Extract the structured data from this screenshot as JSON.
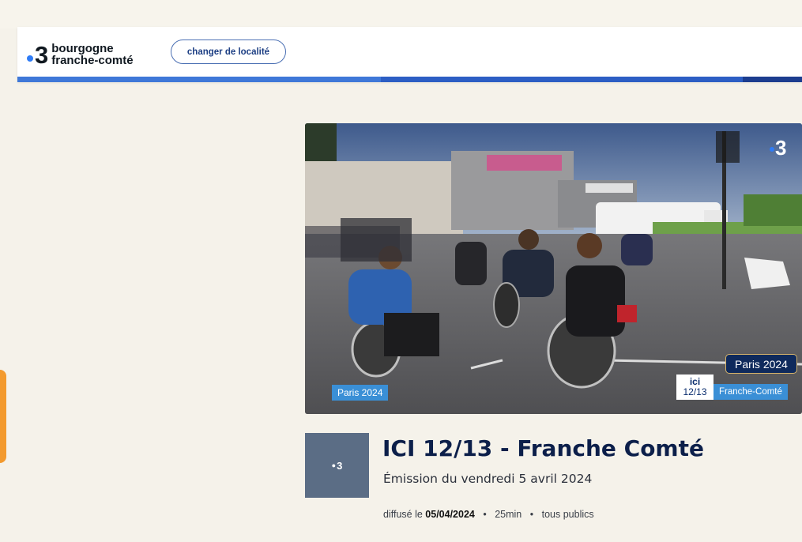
{
  "header": {
    "logo": {
      "number": "3",
      "region_line1": "bourgogne",
      "region_line2": "franche-comté"
    },
    "change_location_label": "changer de localité"
  },
  "video": {
    "tag_left": "Paris 2024",
    "tag_paris_box": "Paris 2024",
    "ici_badge_line1": "ici",
    "ici_badge_line2": "12/13",
    "tag_region": "Franche-Comté",
    "watermark": "3"
  },
  "program": {
    "thumb_label": "3",
    "title": "ICI 12/13 - Franche Comté",
    "subtitle": "Émission du vendredi 5 avril 2024",
    "meta": {
      "prefix": "diffusé le",
      "date": "05/04/2024",
      "duration": "25min",
      "audience": "tous publics",
      "separator": "•"
    }
  },
  "colors": {
    "page_bg": "#f5f2ea",
    "header_bar": "#2c5ec4",
    "accent_orange": "#f39a2e",
    "title": "#0c1f4a",
    "tag_blue": "#3a8fd6"
  }
}
